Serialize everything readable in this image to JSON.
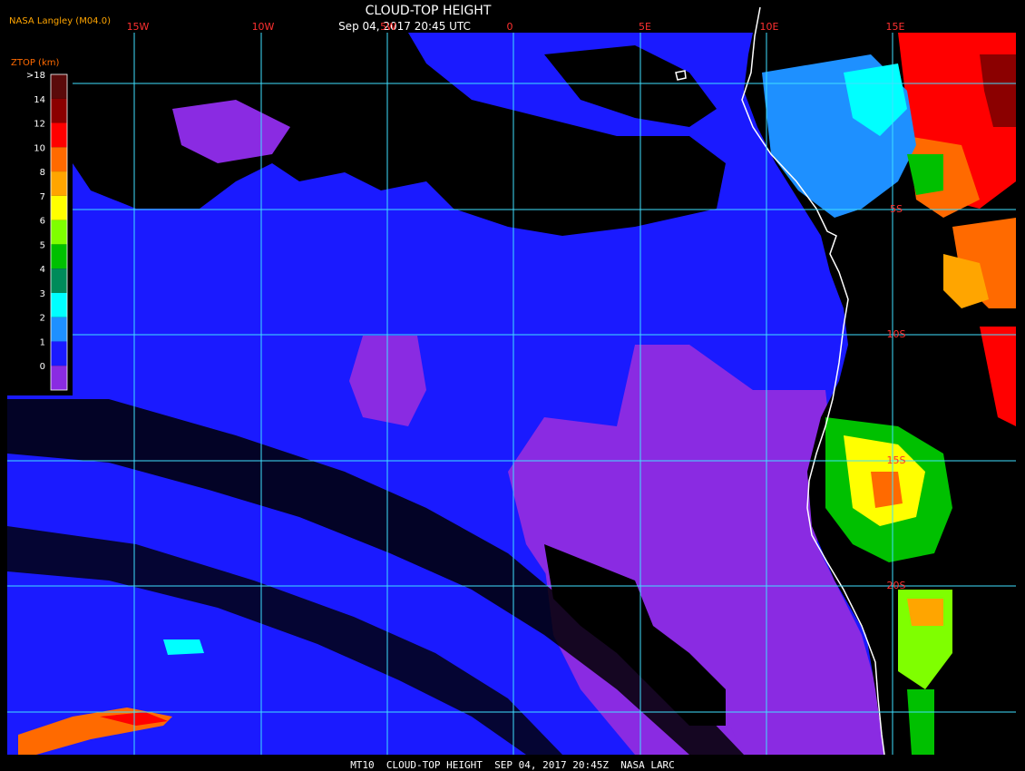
{
  "header": {
    "title": "CLOUD-TOP HEIGHT",
    "date_time": "Sep 04, 2017 20:45 UTC",
    "producer": "NASA Langley (M04.0)"
  },
  "longitude_labels": [
    "15W",
    "10W",
    "5W",
    "0",
    "5E",
    "10E",
    "15E"
  ],
  "latitude_labels": [
    "5S",
    "10S",
    "15S",
    "20S"
  ],
  "legend": {
    "title": "ZTOP (km)",
    "levels": [
      {
        "label": ">18",
        "color": "#5a0a0a"
      },
      {
        "label": "14",
        "color": "#8b0000"
      },
      {
        "label": "12",
        "color": "#ff0000"
      },
      {
        "label": "10",
        "color": "#ff6a00"
      },
      {
        "label": "8",
        "color": "#ffa500"
      },
      {
        "label": "7",
        "color": "#ffff00"
      },
      {
        "label": "6",
        "color": "#7fff00"
      },
      {
        "label": "5",
        "color": "#00c000"
      },
      {
        "label": "4",
        "color": "#008b5a"
      },
      {
        "label": "3",
        "color": "#00ffff"
      },
      {
        "label": "2",
        "color": "#1e90ff"
      },
      {
        "label": "1",
        "color": "#1a1aff"
      },
      {
        "label": "0",
        "color": "#8a2be2"
      }
    ]
  },
  "footer": {
    "caption": "MT10  CLOUD-TOP HEIGHT  SEP 04, 2017 20:45Z  NASA LARC"
  },
  "colors": {
    "background": "#000000",
    "grid": "#40e0ff",
    "coastline": "#ffffff",
    "label_red": "#ff3030",
    "low_cloud_blue": "#1a1aff",
    "surface_purple": "#8a2be2"
  }
}
